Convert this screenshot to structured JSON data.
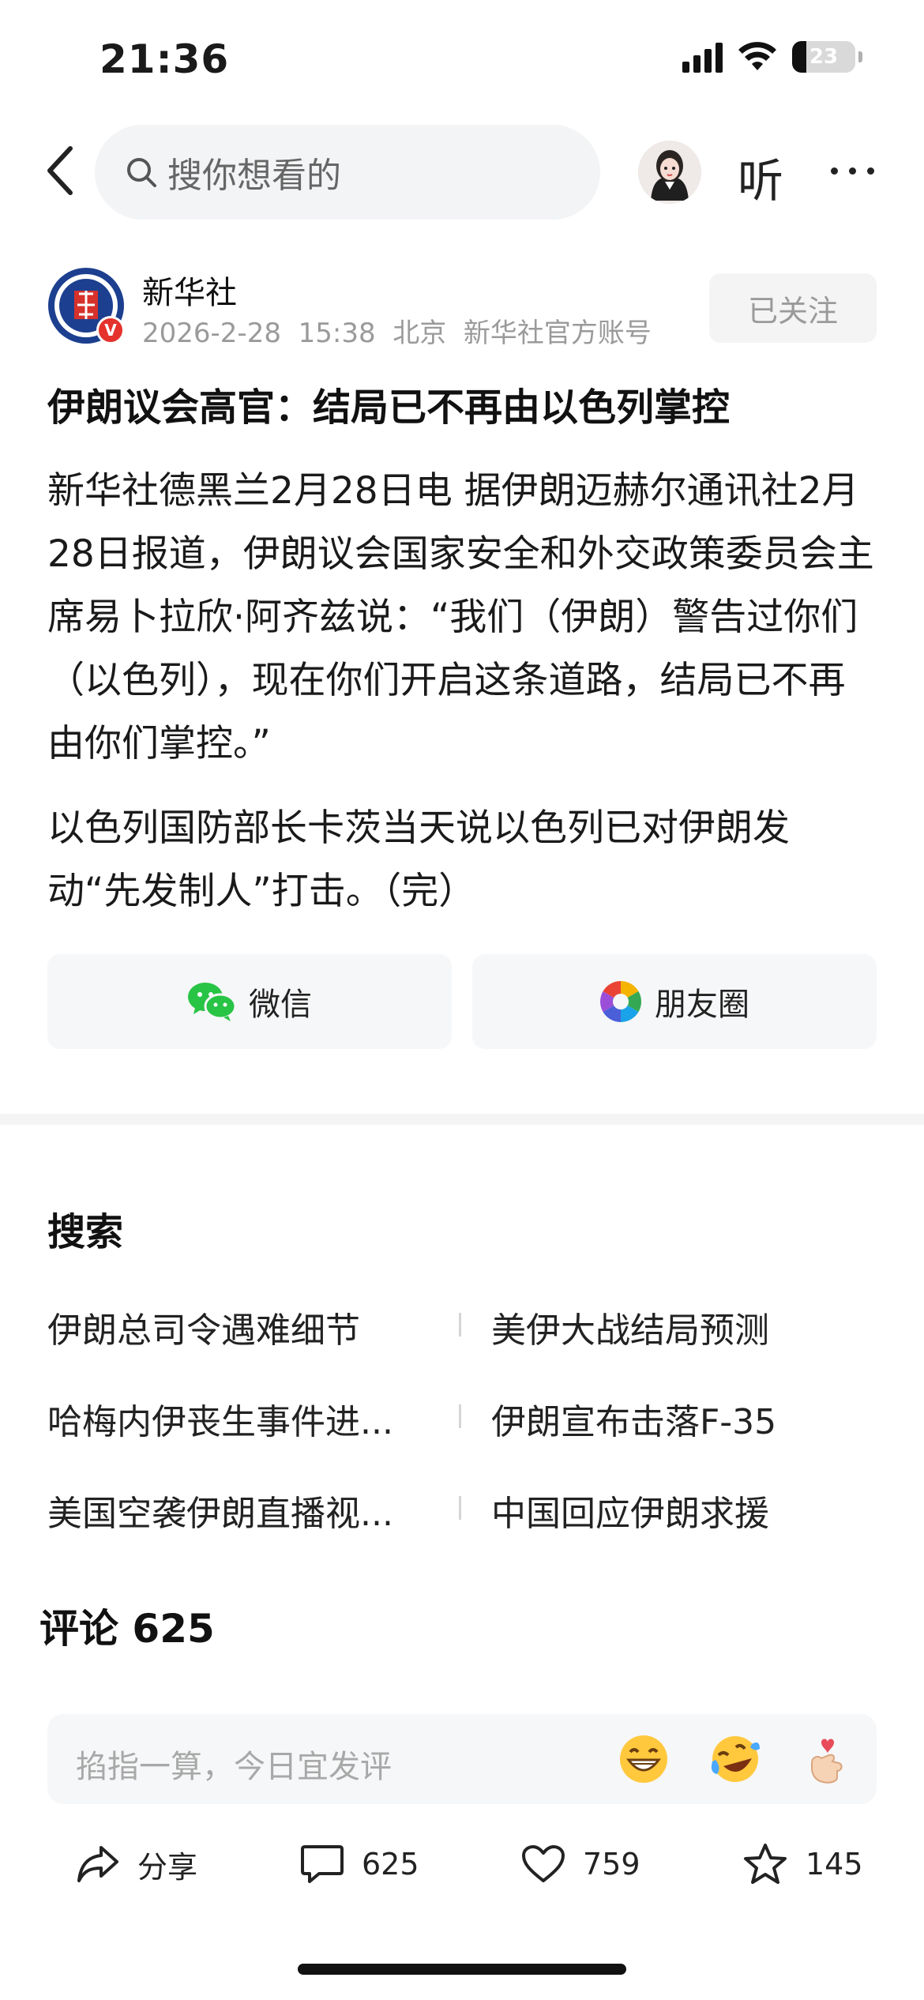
{
  "status_bar": {
    "time": "21:36",
    "battery": "23",
    "battery_level": 0.23
  },
  "nav": {
    "search_placeholder": "搜你想看的",
    "listen_label": "听"
  },
  "author": {
    "name": "新华社",
    "date": "2026-2-28",
    "time": "15:38",
    "location": "北京",
    "account_type": "新华社官方账号",
    "verified_badge": "V",
    "follow_label": "已关注"
  },
  "article": {
    "title": "伊朗议会高官：结局已不再由以色列掌控",
    "paragraphs": [
      "新华社德黑兰2月28日电 据伊朗迈赫尔通讯社2月28日报道，伊朗议会国家安全和外交政策委员会主席易卜拉欣·阿齐兹说：“我们（伊朗）警告过你们（以色列），现在你们开启这条道路，结局已不再由你们掌控。”",
      "以色列国防部长卡茨当天说以色列已对伊朗发动“先发制人”打击。（完）"
    ]
  },
  "share": {
    "wechat_label": "微信",
    "moments_label": "朋友圈"
  },
  "search_section": {
    "title": "搜索",
    "suggestions": [
      [
        "伊朗总司令遇难细节",
        "美伊大战结局预测"
      ],
      [
        "哈梅内伊丧生事件进...",
        "伊朗宣布击落F-35"
      ],
      [
        "美国空袭伊朗直播视...",
        "中国回应伊朗求援"
      ]
    ]
  },
  "comments": {
    "title": "评论 625",
    "input_placeholder": "掐指一算，今日宜发评"
  },
  "bottom_bar": {
    "share_label": "分享",
    "comment_count": "625",
    "like_count": "759",
    "favorite_count": "145"
  }
}
